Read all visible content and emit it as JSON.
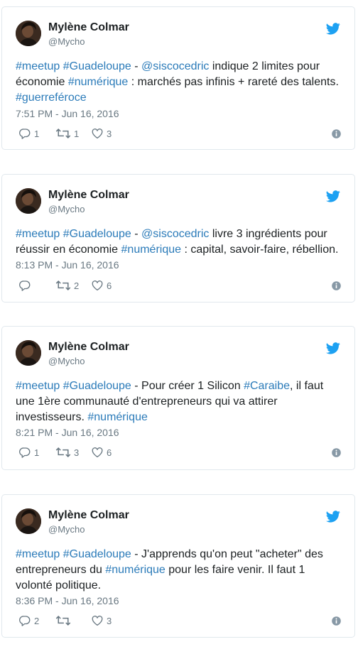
{
  "tweets": [
    {
      "author": "Mylène Colmar",
      "handle": "@Mycho",
      "segments": [
        {
          "t": "#meetup",
          "tag": true
        },
        {
          "t": " ",
          "tag": false
        },
        {
          "t": "#Guadeloupe",
          "tag": true
        },
        {
          "t": " - ",
          "tag": false
        },
        {
          "t": "@siscocedric",
          "tag": true
        },
        {
          "t": " indique 2 limites pour économie ",
          "tag": false
        },
        {
          "t": "#numérique",
          "tag": true
        },
        {
          "t": " : marchés pas infinis + rareté des talents. ",
          "tag": false
        },
        {
          "t": "#guerreféroce",
          "tag": true
        }
      ],
      "timestamp": "7:51 PM - Jun 16, 2016",
      "replies": "1",
      "retweets": "1",
      "likes": "3"
    },
    {
      "author": "Mylène Colmar",
      "handle": "@Mycho",
      "segments": [
        {
          "t": "#meetup",
          "tag": true
        },
        {
          "t": " ",
          "tag": false
        },
        {
          "t": "#Guadeloupe",
          "tag": true
        },
        {
          "t": " - ",
          "tag": false
        },
        {
          "t": "@siscocedric",
          "tag": true
        },
        {
          "t": " livre 3 ingrédients pour réussir en économie ",
          "tag": false
        },
        {
          "t": "#numérique",
          "tag": true
        },
        {
          "t": " : capital, savoir-faire, rébellion.",
          "tag": false
        }
      ],
      "timestamp": "8:13 PM - Jun 16, 2016",
      "replies": "",
      "retweets": "2",
      "likes": "6"
    },
    {
      "author": "Mylène Colmar",
      "handle": "@Mycho",
      "segments": [
        {
          "t": "#meetup",
          "tag": true
        },
        {
          "t": " ",
          "tag": false
        },
        {
          "t": "#Guadeloupe",
          "tag": true
        },
        {
          "t": " - Pour créer 1 Silicon ",
          "tag": false
        },
        {
          "t": "#Caraibe",
          "tag": true
        },
        {
          "t": ", il faut une 1ère communauté d'entrepreneurs qui va attirer investisseurs. ",
          "tag": false
        },
        {
          "t": "#numérique",
          "tag": true
        }
      ],
      "timestamp": "8:21 PM - Jun 16, 2016",
      "replies": "1",
      "retweets": "3",
      "likes": "6"
    },
    {
      "author": "Mylène Colmar",
      "handle": "@Mycho",
      "segments": [
        {
          "t": "#meetup",
          "tag": true
        },
        {
          "t": " ",
          "tag": false
        },
        {
          "t": "#Guadeloupe",
          "tag": true
        },
        {
          "t": " - J'apprends qu'on peut \"acheter\" des entrepreneurs du ",
          "tag": false
        },
        {
          "t": "#numérique",
          "tag": true
        },
        {
          "t": " pour les faire venir. Il faut 1 volonté politique.",
          "tag": false
        }
      ],
      "timestamp": "8:36 PM - Jun 16, 2016",
      "replies": "2",
      "retweets": "",
      "likes": "3"
    }
  ],
  "colors": {
    "link": "#2b7bb9",
    "twitter_blue": "#1da1f2",
    "muted": "#697882",
    "border": "#e1e8ed"
  },
  "icons": [
    "twitter-bird-icon",
    "reply-icon",
    "retweet-icon",
    "like-icon",
    "info-icon"
  ]
}
